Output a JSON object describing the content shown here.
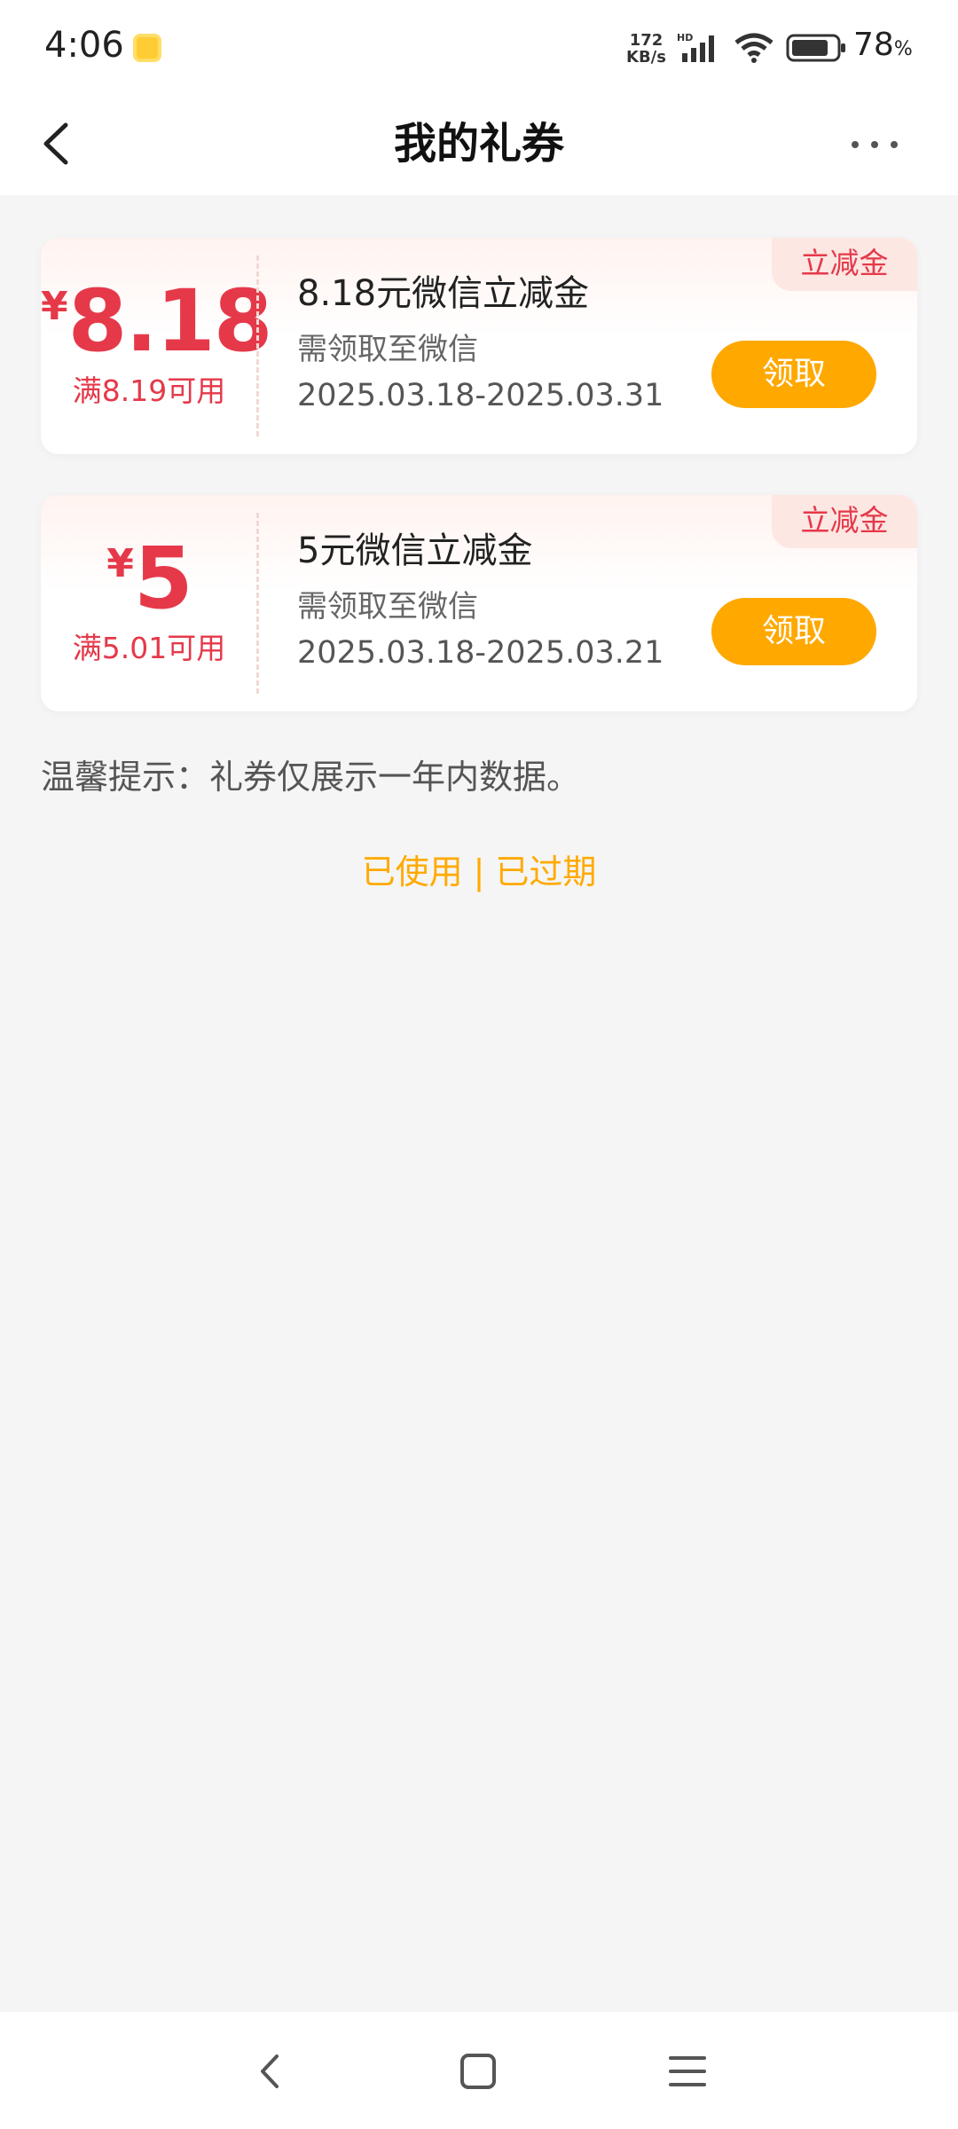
{
  "status_bar": {
    "time": "4:06",
    "net_speed_value": "172",
    "net_speed_unit": "KB/s",
    "battery_level": "78",
    "battery_unit": "%"
  },
  "header": {
    "title": "我的礼券"
  },
  "coupons": [
    {
      "currency": "¥",
      "amount": "8.18",
      "min_spend": "满8.19可用",
      "title": "8.18元微信立减金",
      "description": "需领取至微信",
      "validity": "2025.03.18-2025.03.31",
      "claim_label": "领取",
      "tag": "立减金"
    },
    {
      "currency": "¥",
      "amount": "5",
      "min_spend": "满5.01可用",
      "title": "5元微信立减金",
      "description": "需领取至微信",
      "validity": "2025.03.18-2025.03.21",
      "claim_label": "领取",
      "tag": "立减金"
    }
  ],
  "tip": "温馨提示：礼券仅展示一年内数据。",
  "history": {
    "used_label": "已使用",
    "separator": "|",
    "expired_label": "已过期"
  },
  "colors": {
    "accent_red": "#e5394a",
    "claim_button": "#ffa800",
    "link_orange": "#ffaa00"
  }
}
